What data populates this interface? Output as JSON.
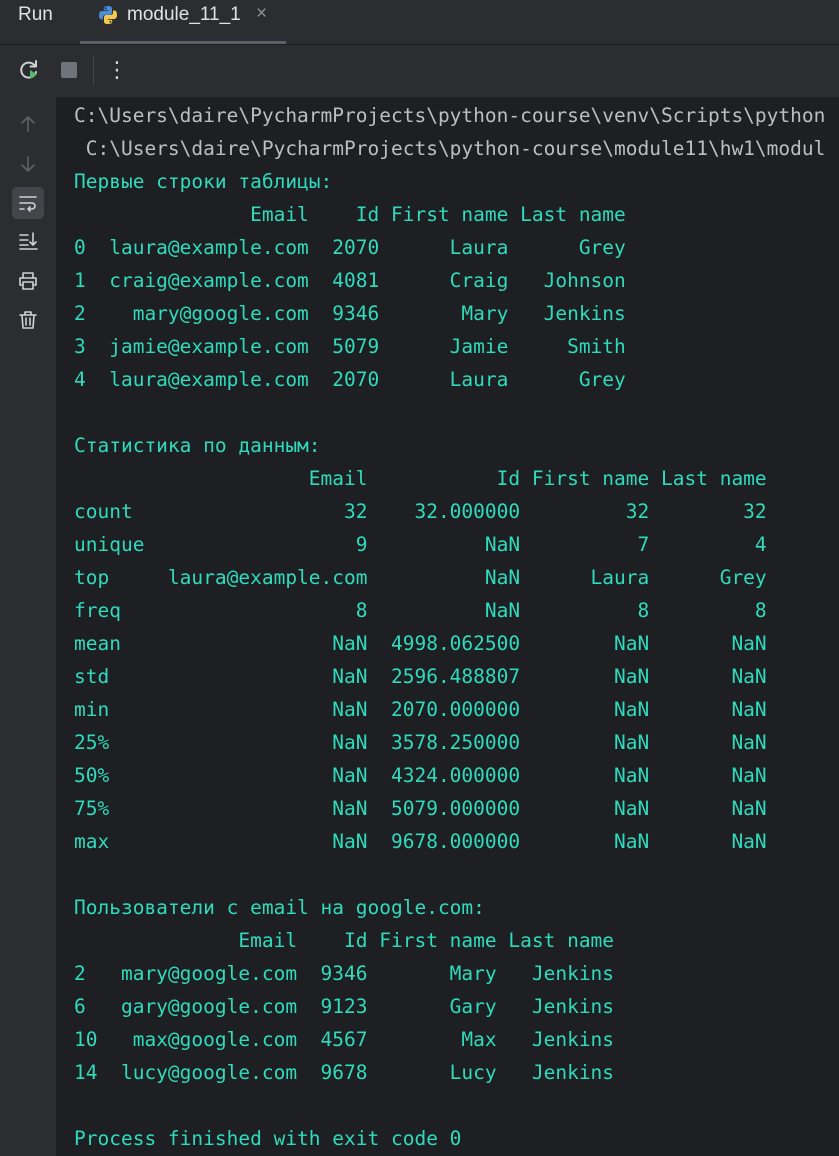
{
  "tabbar": {
    "run_label": "Run",
    "tab_title": "module_11_1",
    "tab_close": "×",
    "tab_icon": "python-icon"
  },
  "toolbar": {
    "rerun_icon": "rerun-icon",
    "stop_icon": "stop-icon",
    "more_icon": "more-vertical-icon",
    "more_glyph": "⋮"
  },
  "gutter": {
    "icons": [
      "arrow-up-icon",
      "arrow-down-icon",
      "soft-wrap-icon",
      "scroll-to-end-icon",
      "print-icon",
      "trash-icon"
    ]
  },
  "console": {
    "lines": [
      "C:\\Users\\daire\\PycharmProjects\\python-course\\venv\\Scripts\\python",
      " C:\\Users\\daire\\PycharmProjects\\python-course\\module11\\hw1\\modul",
      "Первые строки таблицы:",
      "               Email    Id First name Last name",
      "0  laura@example.com  2070      Laura      Grey",
      "1  craig@example.com  4081      Craig   Johnson",
      "2    mary@google.com  9346       Mary   Jenkins",
      "3  jamie@example.com  5079      Jamie     Smith",
      "4  laura@example.com  2070      Laura      Grey",
      "",
      "Статистика по данным:",
      "                    Email           Id First name Last name",
      "count                  32    32.000000         32        32",
      "unique                  9          NaN          7         4",
      "top     laura@example.com          NaN      Laura      Grey",
      "freq                    8          NaN          8         8",
      "mean                  NaN  4998.062500        NaN       NaN",
      "std                   NaN  2596.488807        NaN       NaN",
      "min                   NaN  2070.000000        NaN       NaN",
      "25%                   NaN  3578.250000        NaN       NaN",
      "50%                   NaN  4324.000000        NaN       NaN",
      "75%                   NaN  5079.000000        NaN       NaN",
      "max                   NaN  9678.000000        NaN       NaN",
      "",
      "Пользователи с email на google.com:",
      "              Email    Id First name Last name",
      "2   mary@google.com  9346       Mary   Jenkins",
      "6   gary@google.com  9123       Gary   Jenkins",
      "10   max@google.com  4567        Max   Jenkins",
      "14  lucy@google.com  9678       Lucy   Jenkins",
      "",
      "Process finished with exit code 0"
    ]
  }
}
